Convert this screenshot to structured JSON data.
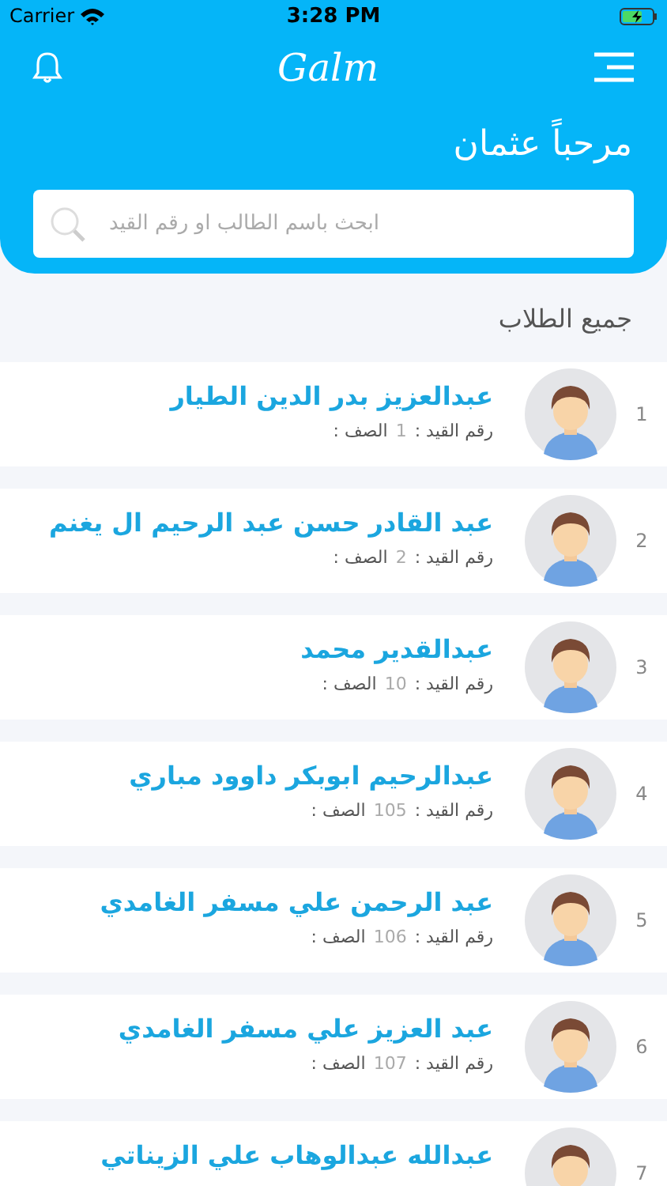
{
  "status_bar": {
    "carrier": "Carrier",
    "time": "3:28 PM"
  },
  "header": {
    "logo": "Galm",
    "greeting": "مرحباً  عثمان"
  },
  "search": {
    "placeholder": "ابحث باسم الطالب او رقم القيد"
  },
  "section_title": "جميع الطلاب",
  "students": [
    {
      "index": "1",
      "name": "عبدالعزيز بدر الدين الطيار",
      "id_label": "رقم القيد :",
      "id": "1",
      "class_label": "الصف :"
    },
    {
      "index": "2",
      "name": "عبد القادر حسن عبد الرحيم ال يغنم",
      "id_label": "رقم القيد :",
      "id": "2",
      "class_label": "الصف :"
    },
    {
      "index": "3",
      "name": "عبدالقدير محمد",
      "id_label": "رقم القيد :",
      "id": "10",
      "class_label": "الصف :"
    },
    {
      "index": "4",
      "name": "عبدالرحيم ابوبكر داوود مباري",
      "id_label": "رقم القيد :",
      "id": "105",
      "class_label": "الصف :"
    },
    {
      "index": "5",
      "name": "عبد الرحمن علي مسفر الغامدي",
      "id_label": "رقم القيد :",
      "id": "106",
      "class_label": "الصف :"
    },
    {
      "index": "6",
      "name": "عبد العزيز علي مسفر الغامدي",
      "id_label": "رقم القيد :",
      "id": "107",
      "class_label": "الصف :"
    },
    {
      "index": "7",
      "name": "عبدالله عبدالوهاب علي الزيناتي"
    }
  ]
}
